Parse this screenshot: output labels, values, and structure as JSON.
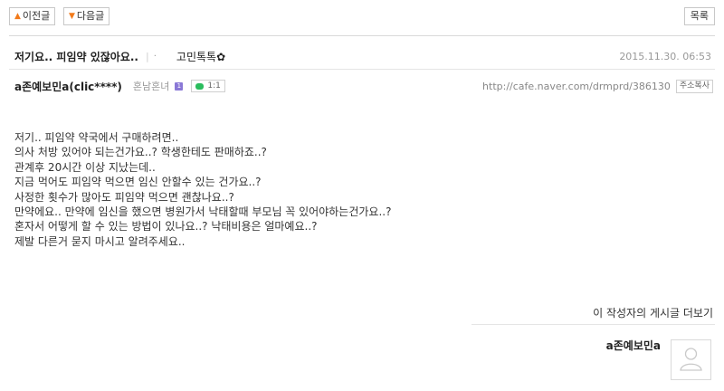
{
  "nav": {
    "prev_label": "이전글",
    "next_label": "다음글",
    "list_label": "목록"
  },
  "post": {
    "title": "저기요.. 피임약 있잖아요..",
    "category": "고민톡톡✿",
    "date": "2015.11.30. 06:53",
    "author": "a존예보민a(clic****)",
    "author_grade": "혼남혼녀",
    "grade_badge": "1",
    "chat_label": "1:1",
    "url": "http://cafe.naver.com/drmprd/386130",
    "copy_url_label": "주소복사",
    "body_lines": [
      "저기.. 피임약 약국에서 구매하려면..",
      "의사 처방 있어야 되는건가요..? 학생한테도 판매하죠..?",
      "관계후 20시간 이상 지났는데..",
      "지금 먹어도 피임약 먹으면 임신 안할수 있는 건가요..?",
      "사정한 횟수가 많아도 피임약 먹으면 괜찮나요..?",
      "만약에요.. 만약에 임신을 했으면 병원가서 낙태할때 부모님 꼭 있어야하는건가요..?",
      "혼자서 어떻게 할 수 있는 방법이 있나요..? 낙태비용은 얼마예요..?",
      "제발 다른거 묻지 마시고 알려주세요.."
    ]
  },
  "profile": {
    "more_posts_label": "이 작성자의 게시글 더보기",
    "nickname": "a존예보민a"
  },
  "colors": {
    "arrow": "#f27a1a",
    "grade_badge": "#8a78d6",
    "chat_icon": "#2bbd5e"
  }
}
